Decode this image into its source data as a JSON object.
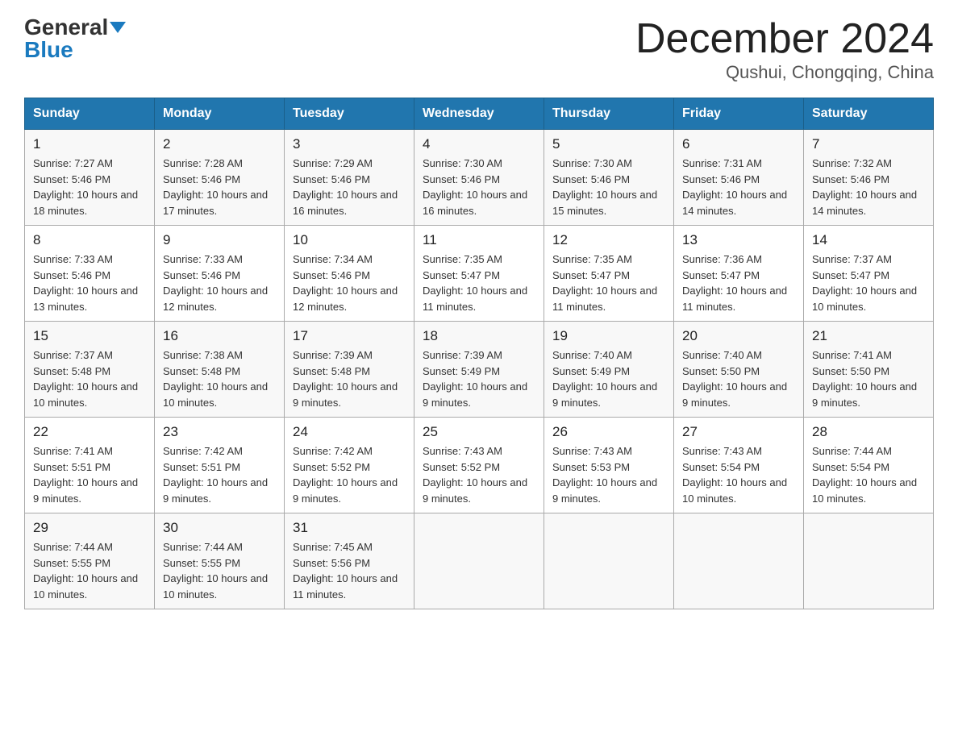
{
  "header": {
    "logo_general": "General",
    "logo_blue": "Blue",
    "month_title": "December 2024",
    "location": "Qushui, Chongqing, China"
  },
  "days_of_week": [
    "Sunday",
    "Monday",
    "Tuesday",
    "Wednesday",
    "Thursday",
    "Friday",
    "Saturday"
  ],
  "weeks": [
    [
      {
        "day": "1",
        "sunrise": "7:27 AM",
        "sunset": "5:46 PM",
        "daylight": "10 hours and 18 minutes."
      },
      {
        "day": "2",
        "sunrise": "7:28 AM",
        "sunset": "5:46 PM",
        "daylight": "10 hours and 17 minutes."
      },
      {
        "day": "3",
        "sunrise": "7:29 AM",
        "sunset": "5:46 PM",
        "daylight": "10 hours and 16 minutes."
      },
      {
        "day": "4",
        "sunrise": "7:30 AM",
        "sunset": "5:46 PM",
        "daylight": "10 hours and 16 minutes."
      },
      {
        "day": "5",
        "sunrise": "7:30 AM",
        "sunset": "5:46 PM",
        "daylight": "10 hours and 15 minutes."
      },
      {
        "day": "6",
        "sunrise": "7:31 AM",
        "sunset": "5:46 PM",
        "daylight": "10 hours and 14 minutes."
      },
      {
        "day": "7",
        "sunrise": "7:32 AM",
        "sunset": "5:46 PM",
        "daylight": "10 hours and 14 minutes."
      }
    ],
    [
      {
        "day": "8",
        "sunrise": "7:33 AM",
        "sunset": "5:46 PM",
        "daylight": "10 hours and 13 minutes."
      },
      {
        "day": "9",
        "sunrise": "7:33 AM",
        "sunset": "5:46 PM",
        "daylight": "10 hours and 12 minutes."
      },
      {
        "day": "10",
        "sunrise": "7:34 AM",
        "sunset": "5:46 PM",
        "daylight": "10 hours and 12 minutes."
      },
      {
        "day": "11",
        "sunrise": "7:35 AM",
        "sunset": "5:47 PM",
        "daylight": "10 hours and 11 minutes."
      },
      {
        "day": "12",
        "sunrise": "7:35 AM",
        "sunset": "5:47 PM",
        "daylight": "10 hours and 11 minutes."
      },
      {
        "day": "13",
        "sunrise": "7:36 AM",
        "sunset": "5:47 PM",
        "daylight": "10 hours and 11 minutes."
      },
      {
        "day": "14",
        "sunrise": "7:37 AM",
        "sunset": "5:47 PM",
        "daylight": "10 hours and 10 minutes."
      }
    ],
    [
      {
        "day": "15",
        "sunrise": "7:37 AM",
        "sunset": "5:48 PM",
        "daylight": "10 hours and 10 minutes."
      },
      {
        "day": "16",
        "sunrise": "7:38 AM",
        "sunset": "5:48 PM",
        "daylight": "10 hours and 10 minutes."
      },
      {
        "day": "17",
        "sunrise": "7:39 AM",
        "sunset": "5:48 PM",
        "daylight": "10 hours and 9 minutes."
      },
      {
        "day": "18",
        "sunrise": "7:39 AM",
        "sunset": "5:49 PM",
        "daylight": "10 hours and 9 minutes."
      },
      {
        "day": "19",
        "sunrise": "7:40 AM",
        "sunset": "5:49 PM",
        "daylight": "10 hours and 9 minutes."
      },
      {
        "day": "20",
        "sunrise": "7:40 AM",
        "sunset": "5:50 PM",
        "daylight": "10 hours and 9 minutes."
      },
      {
        "day": "21",
        "sunrise": "7:41 AM",
        "sunset": "5:50 PM",
        "daylight": "10 hours and 9 minutes."
      }
    ],
    [
      {
        "day": "22",
        "sunrise": "7:41 AM",
        "sunset": "5:51 PM",
        "daylight": "10 hours and 9 minutes."
      },
      {
        "day": "23",
        "sunrise": "7:42 AM",
        "sunset": "5:51 PM",
        "daylight": "10 hours and 9 minutes."
      },
      {
        "day": "24",
        "sunrise": "7:42 AM",
        "sunset": "5:52 PM",
        "daylight": "10 hours and 9 minutes."
      },
      {
        "day": "25",
        "sunrise": "7:43 AM",
        "sunset": "5:52 PM",
        "daylight": "10 hours and 9 minutes."
      },
      {
        "day": "26",
        "sunrise": "7:43 AM",
        "sunset": "5:53 PM",
        "daylight": "10 hours and 9 minutes."
      },
      {
        "day": "27",
        "sunrise": "7:43 AM",
        "sunset": "5:54 PM",
        "daylight": "10 hours and 10 minutes."
      },
      {
        "day": "28",
        "sunrise": "7:44 AM",
        "sunset": "5:54 PM",
        "daylight": "10 hours and 10 minutes."
      }
    ],
    [
      {
        "day": "29",
        "sunrise": "7:44 AM",
        "sunset": "5:55 PM",
        "daylight": "10 hours and 10 minutes."
      },
      {
        "day": "30",
        "sunrise": "7:44 AM",
        "sunset": "5:55 PM",
        "daylight": "10 hours and 10 minutes."
      },
      {
        "day": "31",
        "sunrise": "7:45 AM",
        "sunset": "5:56 PM",
        "daylight": "10 hours and 11 minutes."
      },
      null,
      null,
      null,
      null
    ]
  ]
}
